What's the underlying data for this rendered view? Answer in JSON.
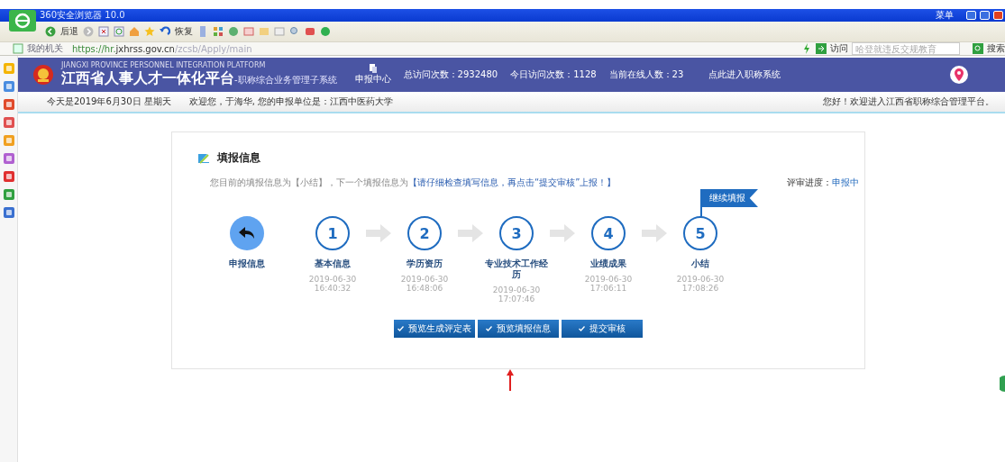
{
  "browser": {
    "title": "360安全浏览器 10.0",
    "menu": "菜单",
    "toolbar": {
      "back": "后退",
      "restore": "恢复"
    },
    "address": {
      "favorites": "我的机关",
      "url_prefix": "https://hr.",
      "url_host": "jxhrss.gov.cn",
      "url_path": "/zcsb/Apply/main",
      "go": "访问",
      "search_placeholder": "哈登就违反交规教育",
      "search": "搜索"
    }
  },
  "header": {
    "subtitle": "JIANGXI PROVINCE PERSONNEL INTEGRATION PLATFORM",
    "title": "江西省人事人才一体化平台",
    "system": "-职称综合业务管理子系统",
    "nav": "申报中心",
    "stats": [
      "总访问次数：2932480",
      "今日访问次数：1128",
      "当前在线人数：23"
    ],
    "link": "点此进入职称系统"
  },
  "subbar": {
    "date": "今天是2019年6月30日 星期天",
    "welcome": "欢迎您，于海华, 您的申报单位是：江西中医药大学",
    "greeting": "您好！欢迎进入江西省职称综合管理平台。"
  },
  "card": {
    "title": "填报信息",
    "info": "您目前的填报信息为【小结】，下一个填报信息为",
    "info_link": "【请仔细检查填写信息，再点击“提交审核”上报！】",
    "progress_label": "评审进度：",
    "progress_value": "申报中",
    "flag": "继续填报",
    "steps": [
      {
        "kind": "back",
        "label": "申报信息",
        "current": false
      },
      {
        "kind": "number",
        "number": "1",
        "label": "基本信息",
        "date": "2019-06-30",
        "time": "16:40:32",
        "current": false
      },
      {
        "kind": "number",
        "number": "2",
        "label": "学历资历",
        "date": "2019-06-30",
        "time": "16:48:06",
        "current": false
      },
      {
        "kind": "number",
        "number": "3",
        "label": "专业技术工作经历",
        "date": "2019-06-30",
        "time": "17:07:46",
        "current": false
      },
      {
        "kind": "number",
        "number": "4",
        "label": "业绩成果",
        "date": "2019-06-30",
        "time": "17:06:11",
        "current": false
      },
      {
        "kind": "number",
        "number": "5",
        "label": "小结",
        "date": "2019-06-30",
        "time": "17:08:26",
        "current": true
      }
    ],
    "buttons": [
      "预览生成评定表",
      "预览填报信息",
      "提交审核"
    ]
  }
}
